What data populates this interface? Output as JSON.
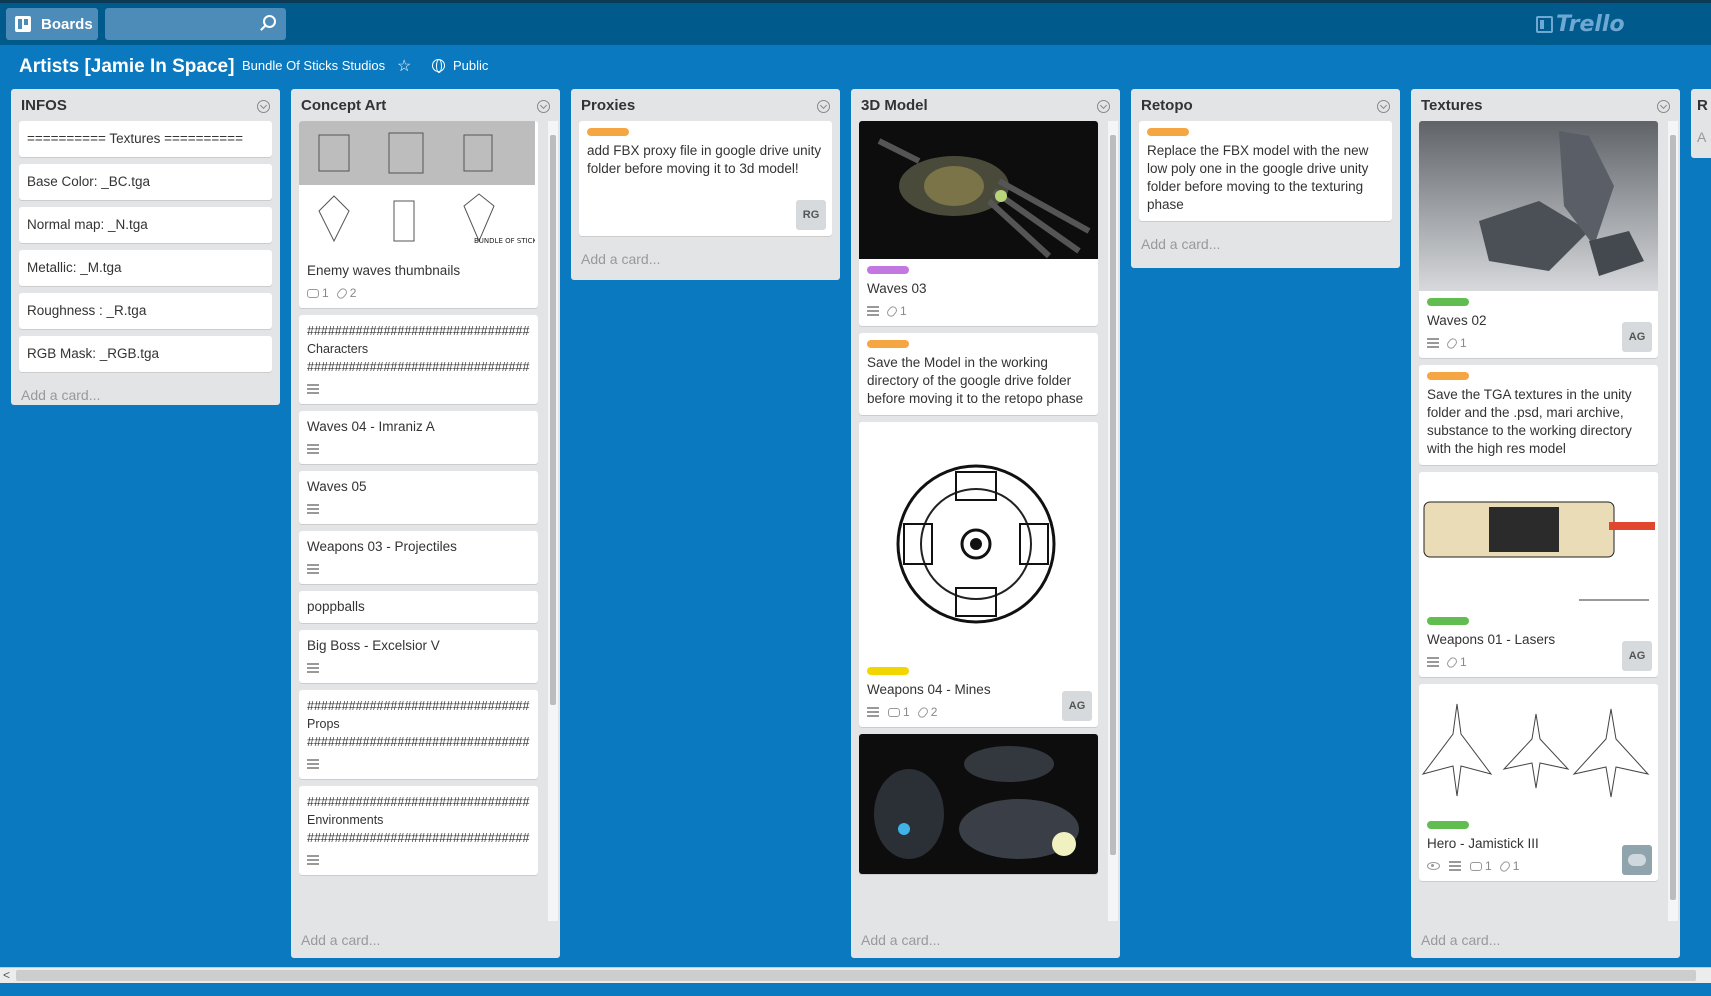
{
  "topbar": {
    "boards_label": "Boards",
    "search_placeholder": "",
    "logo_text": "Trello"
  },
  "board": {
    "title": "Artists [Jamie In Space]",
    "team": "Bundle Of Sticks Studios",
    "visibility": "Public",
    "star": "☆"
  },
  "add_card_label": "Add a card...",
  "colors": {
    "orange": "#f6a543",
    "purple": "#c377e0",
    "yellow": "#f2d600",
    "green": "#61bd4f",
    "board_bg": "#0a79bf"
  },
  "lists": [
    {
      "title": "INFOS",
      "cards": [
        {
          "title": "========== Textures =========="
        },
        {
          "title": "Base Color: _BC.tga"
        },
        {
          "title": "Normal map: _N.tga"
        },
        {
          "title": "Metallic: _M.tga"
        },
        {
          "title": "Roughness : _R.tga"
        },
        {
          "title": "RGB Mask: _RGB.tga"
        }
      ]
    },
    {
      "title": "Concept Art",
      "cards": [
        {
          "title": "Enemy waves thumbnails",
          "comments": "1",
          "attachments": "2"
        },
        {
          "title": "################################ Characters ################################"
        },
        {
          "title": "Waves 04 - Imraniz A"
        },
        {
          "title": "Waves 05"
        },
        {
          "title": "Weapons 03 - Projectiles"
        },
        {
          "title": "poppballs"
        },
        {
          "title": "Big Boss - Excelsior V"
        },
        {
          "title": "################################ Props ################################"
        },
        {
          "title": "################################ Environments ################################"
        }
      ]
    },
    {
      "title": "Proxies",
      "cards": [
        {
          "title": "add FBX proxy file in google drive unity folder before moving it to 3d model!",
          "member": "RG"
        }
      ]
    },
    {
      "title": "3D Model",
      "cards": [
        {
          "title": "Waves 03",
          "attachments": "1"
        },
        {
          "title": "Save the Model in the working directory of the google drive folder before moving it to the retopo phase"
        },
        {
          "title": "Weapons 04 - Mines",
          "comments": "1",
          "attachments": "2",
          "member": "AG"
        }
      ]
    },
    {
      "title": "Retopo",
      "cards": [
        {
          "title": "Replace the FBX model with the new low poly one in the google drive unity folder before moving to the texturing phase"
        }
      ]
    },
    {
      "title": "Textures",
      "cards": [
        {
          "title": "Waves 02",
          "attachments": "1",
          "member": "AG"
        },
        {
          "title": "Save the TGA textures in the unity folder and the .psd, mari archive, substance to the working directory with the high res model"
        },
        {
          "title": "Weapons 01 - Lasers",
          "attachments": "1",
          "member": "AG"
        },
        {
          "title": "Hero - Jamistick III",
          "comments": "1",
          "attachments": "1"
        }
      ]
    },
    {
      "title": "R",
      "add_card_partial": "A"
    }
  ]
}
